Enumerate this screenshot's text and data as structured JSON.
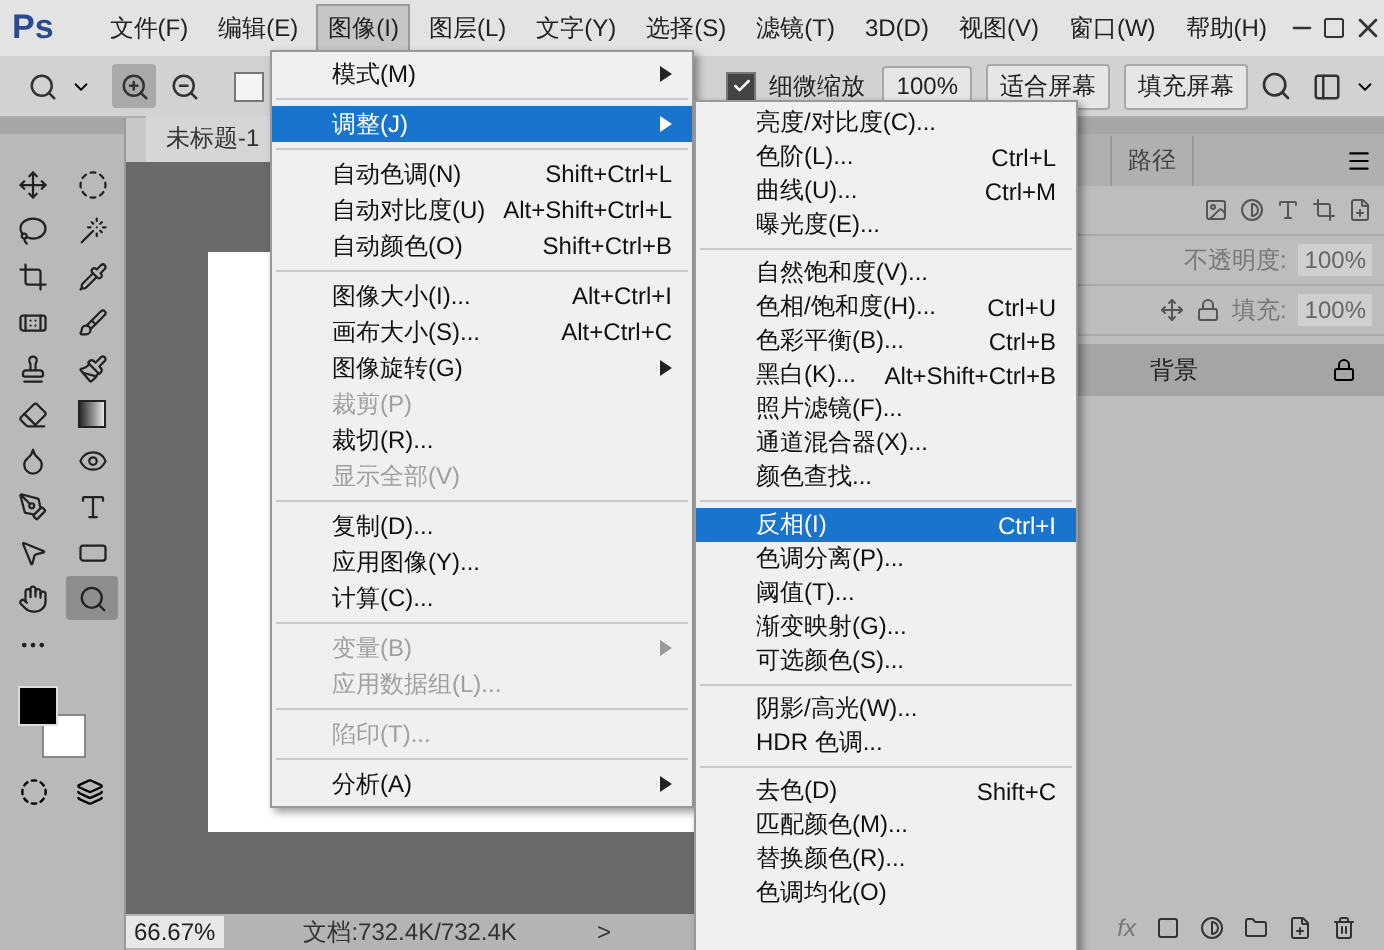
{
  "app": {
    "logo": "Ps"
  },
  "menu_bar": [
    {
      "label": "文件(F)",
      "selected": false
    },
    {
      "label": "编辑(E)",
      "selected": false
    },
    {
      "label": "图像(I)",
      "selected": true
    },
    {
      "label": "图层(L)",
      "selected": false
    },
    {
      "label": "文字(Y)",
      "selected": false
    },
    {
      "label": "选择(S)",
      "selected": false
    },
    {
      "label": "滤镜(T)",
      "selected": false
    },
    {
      "label": "3D(D)",
      "selected": false
    },
    {
      "label": "视图(V)",
      "selected": false
    },
    {
      "label": "窗口(W)",
      "selected": false
    },
    {
      "label": "帮助(H)",
      "selected": false
    }
  ],
  "options_bar": {
    "zoom_modes": [
      {
        "kind": "zoom-in",
        "selected": true
      },
      {
        "kind": "zoom-out",
        "selected": false
      }
    ],
    "checkboxes": [
      {
        "checked": false
      },
      {
        "label": "细微缩放",
        "checked": true
      }
    ],
    "buttons": [
      "100%",
      "适合屏幕",
      "填充屏幕"
    ]
  },
  "toolbar": {
    "tools": [
      {
        "kind": "move",
        "selected": false
      },
      {
        "kind": "marquee",
        "selected": false
      },
      {
        "kind": "lasso",
        "selected": false
      },
      {
        "kind": "wand",
        "selected": false
      },
      {
        "kind": "crop",
        "selected": false
      },
      {
        "kind": "eyedropper",
        "selected": false
      },
      {
        "kind": "healing",
        "selected": false
      },
      {
        "kind": "brush",
        "selected": false
      },
      {
        "kind": "stamp",
        "selected": false
      },
      {
        "kind": "history",
        "selected": false
      },
      {
        "kind": "eraser",
        "selected": false
      },
      {
        "kind": "gradient",
        "selected": false
      },
      {
        "kind": "blur",
        "selected": false
      },
      {
        "kind": "dodge",
        "selected": false
      },
      {
        "kind": "pen",
        "selected": false
      },
      {
        "kind": "type",
        "selected": false
      },
      {
        "kind": "select",
        "selected": false
      },
      {
        "kind": "shape",
        "selected": false
      },
      {
        "kind": "hand",
        "selected": false
      },
      {
        "kind": "zoom",
        "selected": true
      },
      {
        "kind": "more",
        "selected": false
      }
    ]
  },
  "document": {
    "tab_title": "未标题-1",
    "zoom": "66.67%",
    "doc_info": "文档:732.4K/732.4K",
    "status_arrow": ">"
  },
  "layers_panel": {
    "tabs": [
      {
        "label": "路径",
        "selected": false
      }
    ],
    "opacity_label": "不透明度:",
    "opacity": "100%",
    "fill_label": "填充:",
    "fill": "100%",
    "fx": "fx",
    "layers": [
      {
        "name": "背景",
        "locked": true,
        "selected": true
      }
    ]
  },
  "image_menu": {
    "items": [
      {
        "kind": "item",
        "label": "模式(M)",
        "submenu": true,
        "disabled": false,
        "selected": false
      },
      {
        "kind": "separator"
      },
      {
        "kind": "item",
        "label": "调整(J)",
        "submenu": true,
        "disabled": false,
        "selected": true
      },
      {
        "kind": "separator"
      },
      {
        "kind": "item",
        "label": "自动色调(N)",
        "shortcut": "Shift+Ctrl+L",
        "submenu": false,
        "disabled": false,
        "selected": false
      },
      {
        "kind": "item",
        "label": "自动对比度(U)",
        "shortcut": "Alt+Shift+Ctrl+L",
        "submenu": false,
        "disabled": false,
        "selected": false
      },
      {
        "kind": "item",
        "label": "自动颜色(O)",
        "shortcut": "Shift+Ctrl+B",
        "submenu": false,
        "disabled": false,
        "selected": false
      },
      {
        "kind": "separator"
      },
      {
        "kind": "item",
        "label": "图像大小(I)...",
        "shortcut": "Alt+Ctrl+I",
        "submenu": false,
        "disabled": false,
        "selected": false
      },
      {
        "kind": "item",
        "label": "画布大小(S)...",
        "shortcut": "Alt+Ctrl+C",
        "submenu": false,
        "disabled": false,
        "selected": false
      },
      {
        "kind": "item",
        "label": "图像旋转(G)",
        "submenu": true,
        "disabled": false,
        "selected": false
      },
      {
        "kind": "item",
        "label": "裁剪(P)",
        "submenu": false,
        "disabled": true,
        "selected": false
      },
      {
        "kind": "item",
        "label": "裁切(R)...",
        "submenu": false,
        "disabled": false,
        "selected": false
      },
      {
        "kind": "item",
        "label": "显示全部(V)",
        "submenu": false,
        "disabled": true,
        "selected": false
      },
      {
        "kind": "separator"
      },
      {
        "kind": "item",
        "label": "复制(D)...",
        "submenu": false,
        "disabled": false,
        "selected": false
      },
      {
        "kind": "item",
        "label": "应用图像(Y)...",
        "submenu": false,
        "disabled": false,
        "selected": false
      },
      {
        "kind": "item",
        "label": "计算(C)...",
        "submenu": false,
        "disabled": false,
        "selected": false
      },
      {
        "kind": "separator"
      },
      {
        "kind": "item",
        "label": "变量(B)",
        "submenu": true,
        "disabled": true,
        "selected": false
      },
      {
        "kind": "item",
        "label": "应用数据组(L)...",
        "submenu": false,
        "disabled": true,
        "selected": false
      },
      {
        "kind": "separator"
      },
      {
        "kind": "item",
        "label": "陷印(T)...",
        "submenu": false,
        "disabled": true,
        "selected": false
      },
      {
        "kind": "separator"
      },
      {
        "kind": "item",
        "label": "分析(A)",
        "submenu": true,
        "disabled": false,
        "selected": false
      }
    ]
  },
  "adjustments_submenu": {
    "items": [
      {
        "kind": "item",
        "label": "亮度/对比度(C)...",
        "selected": false
      },
      {
        "kind": "item",
        "label": "色阶(L)...",
        "shortcut": "Ctrl+L",
        "selected": false
      },
      {
        "kind": "item",
        "label": "曲线(U)...",
        "shortcut": "Ctrl+M",
        "selected": false
      },
      {
        "kind": "item",
        "label": "曝光度(E)...",
        "selected": false
      },
      {
        "kind": "separator"
      },
      {
        "kind": "item",
        "label": "自然饱和度(V)...",
        "selected": false
      },
      {
        "kind": "item",
        "label": "色相/饱和度(H)...",
        "shortcut": "Ctrl+U",
        "selected": false
      },
      {
        "kind": "item",
        "label": "色彩平衡(B)...",
        "shortcut": "Ctrl+B",
        "selected": false
      },
      {
        "kind": "item",
        "label": "黑白(K)...",
        "shortcut": "Alt+Shift+Ctrl+B",
        "selected": false
      },
      {
        "kind": "item",
        "label": "照片滤镜(F)...",
        "selected": false
      },
      {
        "kind": "item",
        "label": "通道混合器(X)...",
        "selected": false
      },
      {
        "kind": "item",
        "label": "颜色查找...",
        "selected": false
      },
      {
        "kind": "separator"
      },
      {
        "kind": "item",
        "label": "反相(I)",
        "shortcut": "Ctrl+I",
        "selected": true
      },
      {
        "kind": "item",
        "label": "色调分离(P)...",
        "selected": false
      },
      {
        "kind": "item",
        "label": "阈值(T)...",
        "selected": false
      },
      {
        "kind": "item",
        "label": "渐变映射(G)...",
        "selected": false
      },
      {
        "kind": "item",
        "label": "可选颜色(S)...",
        "selected": false
      },
      {
        "kind": "separator"
      },
      {
        "kind": "item",
        "label": "阴影/高光(W)...",
        "selected": false
      },
      {
        "kind": "item",
        "label": "HDR 色调...",
        "selected": false
      },
      {
        "kind": "separator"
      },
      {
        "kind": "item",
        "label": "去色(D)",
        "shortcut": "Shift+C",
        "selected": false
      },
      {
        "kind": "item",
        "label": "匹配颜色(M)...",
        "selected": false
      },
      {
        "kind": "item",
        "label": "替换颜色(R)...",
        "selected": false
      },
      {
        "kind": "item",
        "label": "色调均化(O)",
        "selected": false
      }
    ]
  }
}
